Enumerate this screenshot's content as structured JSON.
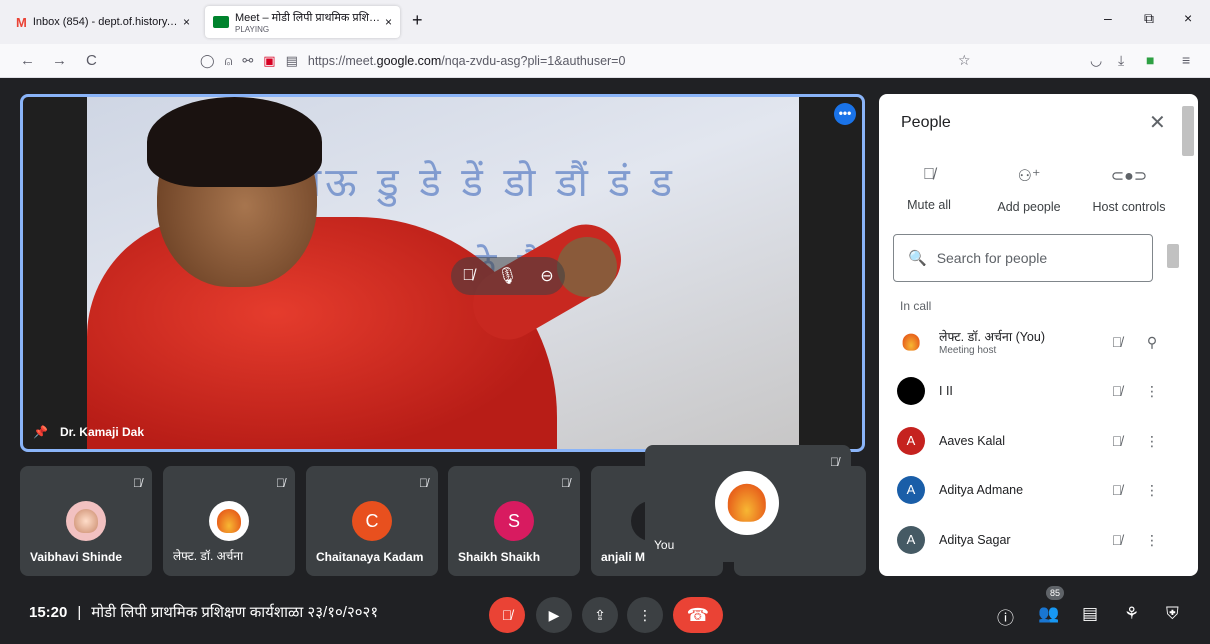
{
  "browser": {
    "tabs": [
      {
        "title": "Inbox (854) - dept.of.history.rsm",
        "close": "×"
      },
      {
        "title": "Meet – मोडी लिपी प्राथमिक प्रशिक्षण",
        "subtitle": "PLAYING",
        "close": "×"
      }
    ],
    "new_tab": "+",
    "window_controls": [
      "–",
      "⧉",
      "×"
    ],
    "nav": {
      "back": "←",
      "forward": "→",
      "reload": "C"
    },
    "url": {
      "prefix": "https://meet.",
      "domain": "google.com",
      "path": "/nqa-zvdu-asg?pli=1&authuser=0"
    }
  },
  "stage": {
    "speaker_name": "Dr. Kamaji Dak",
    "board_line1": "ाऊ डु डे डें डो डौं डं ड",
    "board_line2": "छ घा ढी घु छे छै",
    "more": "•••"
  },
  "tiles": [
    {
      "name": "Vaibhavi Shinde",
      "avatar": "",
      "color": "#f2c1c1"
    },
    {
      "name": "लेफ्ट. डॉ. अर्चना",
      "avatar": "",
      "color": "#ffffff"
    },
    {
      "name": "Chaitanaya Kadam",
      "avatar": "C",
      "color": "#e8501e"
    },
    {
      "name": "Shaikh Shaikh",
      "avatar": "S",
      "color": "#d81b60"
    },
    {
      "name": "anjali M",
      "avatar": "",
      "color": "#202124"
    }
  ],
  "self_view": {
    "name": "You"
  },
  "bottombar": {
    "time": "15:20",
    "separator": "|",
    "meeting_name": "मोडी लिपी प्राथमिक प्रशिक्षण कार्यशाळा २३/१०/२०२१",
    "participant_count": "85"
  },
  "people_panel": {
    "title": "People",
    "actions": [
      {
        "label": "Mute all"
      },
      {
        "label": "Add people"
      },
      {
        "label": "Host controls"
      }
    ],
    "search_placeholder": "Search for people",
    "section": "In call",
    "people": [
      {
        "name": "लेफ्ट. डॉ. अर्चना (You)",
        "role": "Meeting host",
        "avatar": "",
        "color": "#ffffff"
      },
      {
        "name": "I II",
        "role": "",
        "avatar": "",
        "color": "#000000"
      },
      {
        "name": "Aaves Kalal",
        "role": "",
        "avatar": "A",
        "color": "#c5221f"
      },
      {
        "name": "Aditya Admane",
        "role": "",
        "avatar": "A",
        "color": "#1a5ea8"
      },
      {
        "name": "Aditya Sagar",
        "role": "",
        "avatar": "A",
        "color": "#455a64"
      }
    ]
  }
}
